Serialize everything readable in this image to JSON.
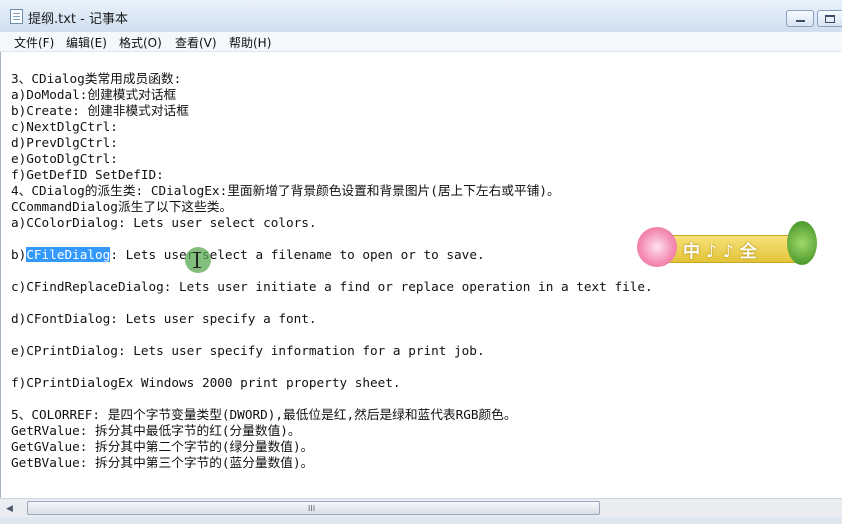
{
  "window": {
    "title": "提纲.txt - 记事本"
  },
  "menu": {
    "items": [
      "文件(F)",
      "编辑(E)",
      "格式(O)",
      "查看(V)",
      "帮助(H)"
    ]
  },
  "editor": {
    "lines": [
      "3、CDialog类常用成员函数:",
      "a)DoModal:创建模式对话框",
      "b)Create: 创建非模式对话框",
      "c)NextDlgCtrl:",
      "d)PrevDlgCtrl:",
      "e)GotoDlgCtrl:",
      "f)GetDefID SetDefID:",
      "4、CDialog的派生类: CDialogEx:里面新增了背景颜色设置和背景图片(居上下左右或平铺)。",
      "CCommandDialog派生了以下这些类。",
      "a)CColorDialog: Lets user select colors.",
      "",
      "c)CFindReplaceDialog: Lets user initiate a find or replace operation in a text file.",
      "",
      "d)CFontDialog: Lets user specify a font.",
      "",
      "e)CPrintDialog: Lets user specify information for a print job.",
      "",
      "f)CPrintDialogEx Windows 2000 print property sheet.",
      "",
      "5、COLORREF: 是四个字节变量类型(DWORD),最低位是红,然后是绿和蓝代表RGB颜色。",
      "GetRValue: 拆分其中最低字节的红(分量数值)。",
      "GetGValue: 拆分其中第二个字节的(绿分量数值)。",
      "GetBValue: 拆分其中第三个字节的(蓝分量数值)。"
    ],
    "selected_line": {
      "prefix": "b)",
      "selected": "CFileDialog",
      "suffix": ": Lets user select a filename to open or to save."
    }
  },
  "sticker": {
    "text": "中♪♪全"
  },
  "scrollbar": {
    "left_arrow": "◀",
    "grip": "III"
  }
}
